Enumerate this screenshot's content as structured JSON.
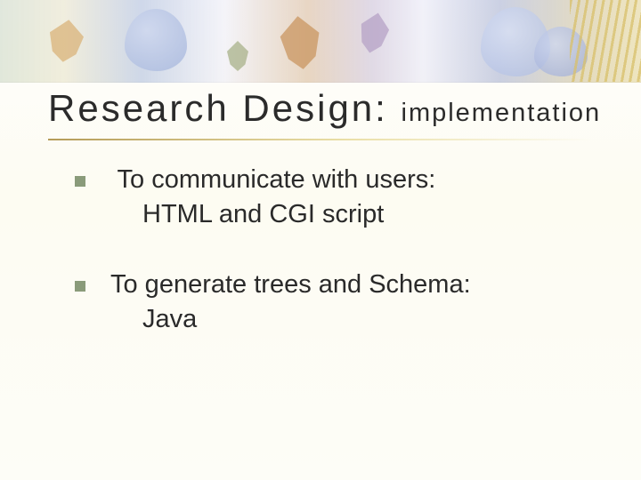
{
  "title_main": "Research Design:",
  "title_sub": "implementation",
  "bullets": [
    {
      "line1": " To communicate with users:",
      "line2": "HTML and CGI script"
    },
    {
      "line1": "To generate trees and Schema:",
      "line2": "Java"
    }
  ]
}
